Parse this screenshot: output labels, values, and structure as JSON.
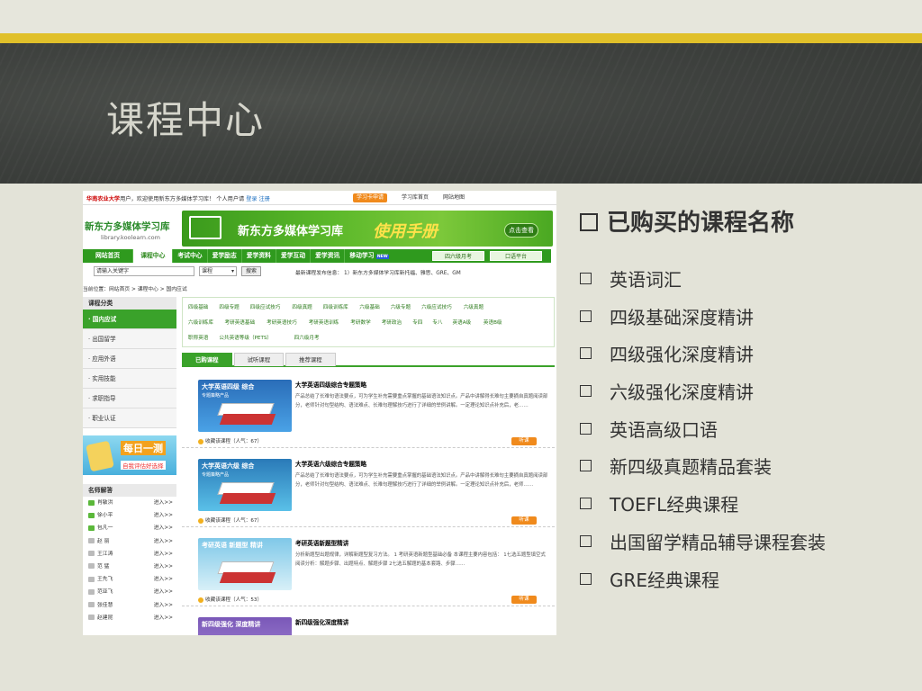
{
  "slide": {
    "title": "课程中心",
    "purchased_heading": "已购买的课程名称",
    "purchased_courses": [
      "英语词汇",
      "四级基础深度精讲",
      "四级强化深度精讲",
      "六级强化深度精讲",
      "英语高级口语",
      "新四级真题精品套装",
      "TOEFL经典课程",
      "出国留学精品辅导课程套装",
      "GRE经典课程"
    ]
  },
  "screenshot": {
    "topbar": {
      "school": "华南农业大学",
      "welcome": "用户，欢迎使用新东方多媒体学习库！ 个人用户请",
      "login": "登录",
      "register": "注册",
      "buttons": [
        "学习卡申请",
        "学习库首页",
        "网站地图"
      ]
    },
    "logo": {
      "name": "新东方多媒体学习库",
      "url": "library.koolearn.com"
    },
    "banner": {
      "text1": "新东方多媒体学习库",
      "text2": "使用手册",
      "button": "点击查看"
    },
    "nav": {
      "items": [
        "网站首页",
        "课程中心",
        "考试中心",
        "爱学励志",
        "爱学资料",
        "爱学互动",
        "爱学资讯",
        "移动学习"
      ],
      "active_index": 1,
      "new_badge": "NEW",
      "right_buttons": [
        "四六级月考",
        "口语平台"
      ]
    },
    "search": {
      "placeholder": "请输入关键字",
      "type": "课程",
      "button": "搜索",
      "news": "最新课程发布信息：                        1）新东方多媒体学习库新托福、雅思、GRE、GM"
    },
    "breadcrumb": "当前位置：网站首页 > 课程中心 > 国内应试",
    "sidebar": {
      "header": "课程分类",
      "items": [
        "· 国内应试",
        "· 出国留学",
        "· 应用外语",
        "· 实用技能",
        "· 求职指导",
        "· 职业认证"
      ],
      "active_index": 0
    },
    "daily_test": {
      "title": "每日一测",
      "subtitle": "自我评估好选择"
    },
    "teachers": {
      "header": "名师解答",
      "enter_label": "进入>>",
      "list": [
        "肖敏洪",
        "徐小平",
        "包凡一",
        "赵  丽",
        "王江涛",
        "范  猛",
        "王先飞",
        "范亚飞",
        "张佳慧",
        "赵建昆"
      ],
      "online": [
        true,
        true,
        true,
        false,
        false,
        false,
        false,
        false,
        false,
        false
      ]
    },
    "categories": [
      [
        "四级基础",
        "四级专题",
        "四级应试技巧",
        "四级真题",
        "四级训练库",
        "六级基础",
        "六级专题",
        "六级应试技巧",
        "六级真题"
      ],
      [
        "六级训练库",
        "考研英语基础",
        "考研英语技巧",
        "考研英语训练",
        "考研数学",
        "考研政治",
        "专四",
        "专八",
        "英语A级",
        "英语B级"
      ],
      [
        "职称英语",
        "公共英语等级（PETS）",
        "四六级月考"
      ]
    ],
    "tabs": [
      "已购课程",
      "试听课程",
      "推荐课程"
    ],
    "active_tab": 0,
    "courses": [
      {
        "image_caption": "大学英语四级 综合",
        "image_sub": "专题策略产品",
        "title": "大学英语四级综合专题策略",
        "desc": "产品总结了长难句语法要点，可为学生补充需要重点掌握的基础语法知识点。产品中讲解得长难句主要摘自真题阅读部分，老师针对句型结构、语法难点、长难句理解技巧进行了详细的举例讲解。一定理论知识点补充后，老……",
        "fav": "收藏该课程（人气：67）",
        "button": "听课",
        "colors": [
          "#2a6db8",
          "#4aa2e6"
        ]
      },
      {
        "image_caption": "大学英语六级 综合",
        "image_sub": "专题策略产品",
        "title": "大学英语六级综合专题策略",
        "desc": "产品总结了长难句语法要点，可为学生补充需要重点掌握的基础语法知识点。产品中讲解得长难句主要摘自真题阅读部分，老师针对句型结构、语法难点、长难句理解技巧进行了详细的举例讲解。一定理论知识点补充后，老师……",
        "fav": "收藏该课程（人气：67）",
        "button": "听课",
        "colors": [
          "#2a7ab8",
          "#5ac0e8"
        ]
      },
      {
        "image_caption": "考研英语 新题型 精讲",
        "image_sub": "",
        "title": "考研英语新题型精讲",
        "desc": "分析新题型出题规律，详解新题型复习方法。    1 考研英语新题型基础必备    本课程主要内容包括：     1七选五题型填空式阅读分析：解题步骤、出题特点、解题步骤    2七选五解题的基本套路、步骤……",
        "fav": "收藏该课程（人气：53）",
        "button": "听课",
        "colors": [
          "#7fc8e8",
          "#d8f0f8"
        ]
      },
      {
        "image_caption": "新四级强化 深度精讲",
        "image_sub": "",
        "title": "新四级强化深度精讲",
        "desc": "",
        "fav": "",
        "button": "",
        "colors": [
          "#7a58b8",
          "#a88ad8"
        ]
      }
    ]
  },
  "colors": {
    "accent_gold": "#e0c02a",
    "chalkboard": "#3f423f",
    "slide_bg": "#e3e3d8",
    "site_green": "#2f9a1e",
    "site_orange": "#f08a1c"
  }
}
